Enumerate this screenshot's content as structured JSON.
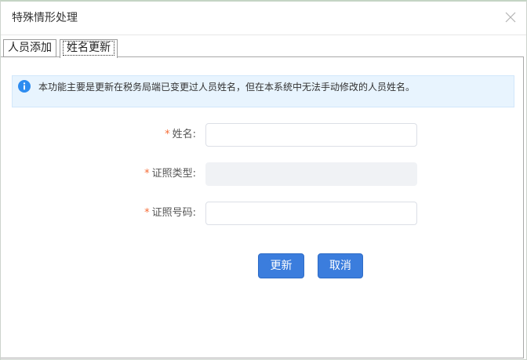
{
  "dialog": {
    "title": "特殊情形处理",
    "close_icon": "close-icon"
  },
  "tabs": [
    {
      "label": "人员添加",
      "selected": false
    },
    {
      "label": "姓名更新",
      "selected": true
    }
  ],
  "info": {
    "icon": "info-icon",
    "text": "本功能主要是更新在税务局端已变更过人员姓名，但在本系统中无法手动修改的人员姓名。"
  },
  "form": {
    "required_mark": "*",
    "fields": [
      {
        "label": "姓名:",
        "value": "",
        "disabled": false
      },
      {
        "label": "证照类型:",
        "value": "",
        "disabled": true
      },
      {
        "label": "证照号码:",
        "value": "",
        "disabled": false
      }
    ]
  },
  "actions": {
    "update_label": "更新",
    "cancel_label": "取消"
  },
  "colors": {
    "accent": "#3b7ddd",
    "required_mark": "#f56c36",
    "info_icon": "#2d8cf0",
    "info_background": "#e8f4fe",
    "disabled_field": "#f0f2f5"
  }
}
